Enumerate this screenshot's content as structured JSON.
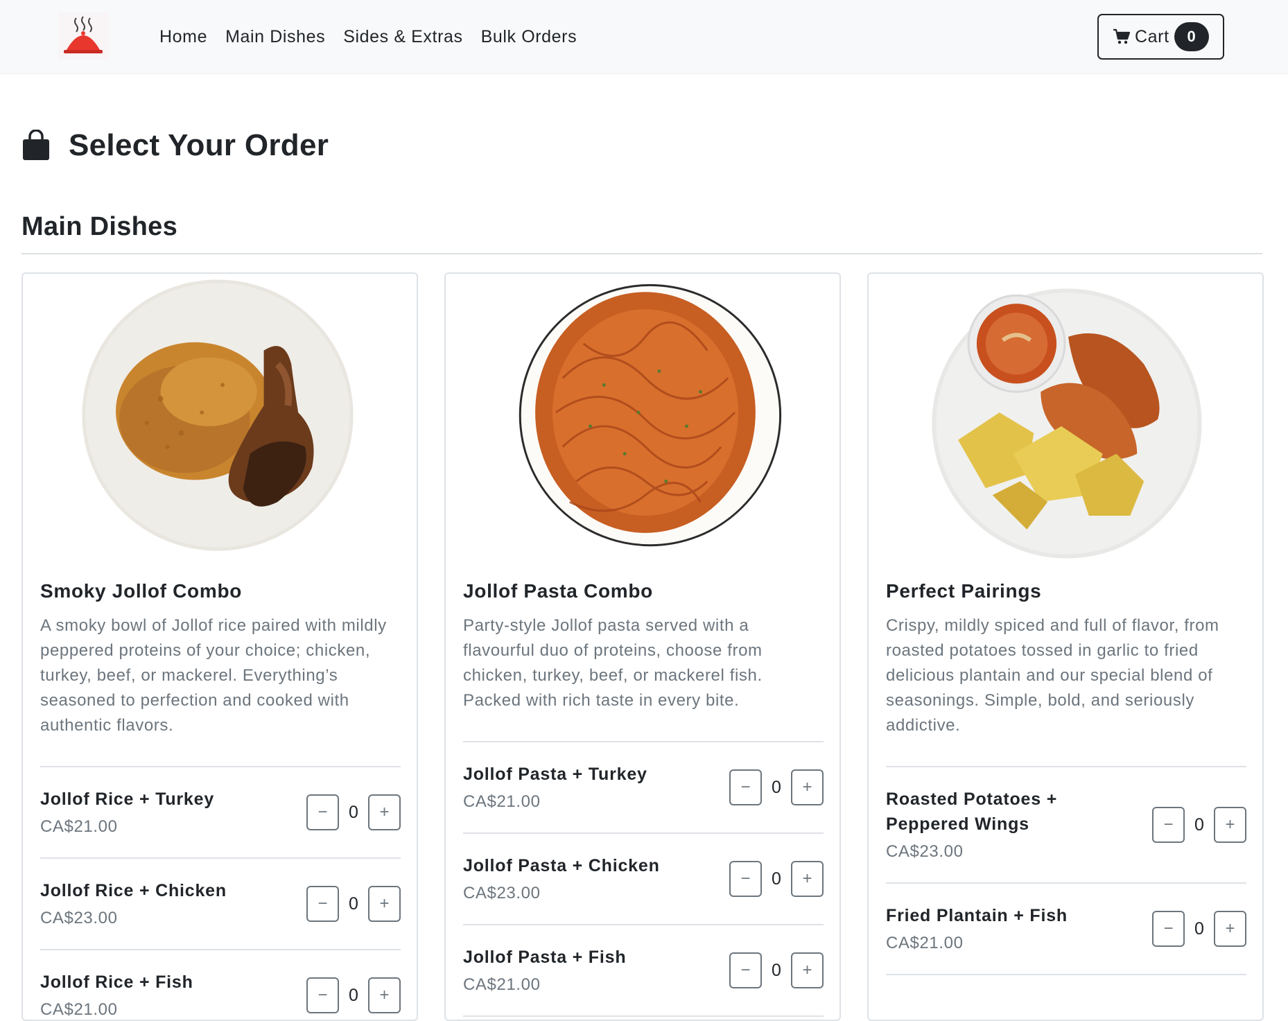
{
  "nav": {
    "links": [
      "Home",
      "Main Dishes",
      "Sides & Extras",
      "Bulk Orders"
    ],
    "cart_label": "Cart",
    "cart_count": "0"
  },
  "page_title": "Select Your Order",
  "section_title": "Main Dishes",
  "cards": [
    {
      "title": "Smoky Jollof Combo",
      "description": "A smoky bowl of Jollof rice paired with mildly peppered proteins of your choice; chicken, turkey, beef, or mackerel. Everything’s seasoned to perfection and cooked with authentic flavors.",
      "options": [
        {
          "name": "Jollof Rice + Turkey",
          "price": "CA$21.00",
          "qty": "0"
        },
        {
          "name": "Jollof Rice + Chicken",
          "price": "CA$23.00",
          "qty": "0"
        },
        {
          "name": "Jollof Rice + Fish",
          "price": "CA$21.00",
          "qty": "0"
        }
      ]
    },
    {
      "title": "Jollof Pasta Combo",
      "description": "Party-style Jollof pasta served with a flavourful duo of proteins, choose from chicken, turkey, beef, or mackerel fish. Packed with rich taste in every bite.",
      "options": [
        {
          "name": "Jollof Pasta + Turkey",
          "price": "CA$21.00",
          "qty": "0"
        },
        {
          "name": "Jollof Pasta + Chicken",
          "price": "CA$23.00",
          "qty": "0"
        },
        {
          "name": "Jollof Pasta + Fish",
          "price": "CA$21.00",
          "qty": "0"
        }
      ]
    },
    {
      "title": "Perfect Pairings",
      "description": "Crispy, mildly spiced and full of flavor, from roasted potatoes tossed in garlic to fried delicious plantain and our special blend of seasonings. Simple, bold, and seriously addictive.",
      "options": [
        {
          "name": "Roasted Potatoes + Peppered Wings",
          "price": "CA$23.00",
          "qty": "0"
        },
        {
          "name": "Fried Plantain + Fish",
          "price": "CA$21.00",
          "qty": "0"
        }
      ]
    }
  ],
  "stepper": {
    "minus": "−",
    "plus": "+"
  }
}
